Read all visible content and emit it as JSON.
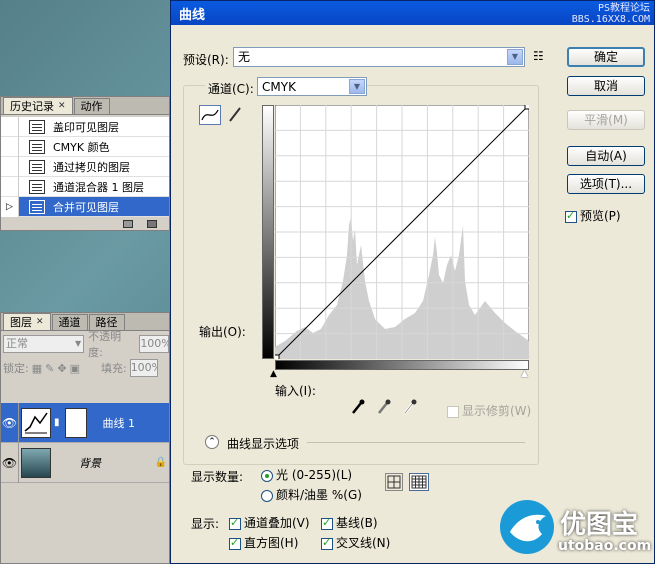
{
  "history_panel": {
    "tabs": [
      {
        "label": "历史记录"
      },
      {
        "label": "动作"
      }
    ],
    "items": [
      {
        "label": "盖印可见图层"
      },
      {
        "label": "CMYK 颜色"
      },
      {
        "label": "通过拷贝的图层"
      },
      {
        "label": "通道混合器 1 图层"
      },
      {
        "label": "合并可见图层"
      }
    ],
    "selected_index": 4
  },
  "layers_panel": {
    "tabs": [
      {
        "label": "图层"
      },
      {
        "label": "通道"
      },
      {
        "label": "路径"
      }
    ],
    "blend_mode": "正常",
    "opacity_label": "不透明度:",
    "opacity_value": "100%",
    "lock_label": "锁定:",
    "fill_label": "填充:",
    "fill_value": "100%",
    "layers": [
      {
        "name": "曲线 1",
        "selected": true
      },
      {
        "name": "背景",
        "selected": false
      }
    ]
  },
  "dialog": {
    "title": "曲线",
    "watermark_line1": "PS教程论坛",
    "watermark_line2": "BBS.16XX8.COM",
    "preset_label": "预设(R):",
    "preset_value": "无",
    "channel_label": "通道(C):",
    "channel_value": "CMYK",
    "output_label": "输出(O):",
    "input_label": "输入(I):",
    "show_clipping_label": "显示修剪(W)",
    "curve_options_label": "曲线显示选项",
    "show_amount_label": "显示数量:",
    "light_label": "光 (0-255)(L)",
    "pigment_label": "颜料/油墨 %(G)",
    "show_label": "显示:",
    "channel_overlay_label": "通道叠加(V)",
    "baseline_label": "基线(B)",
    "histogram_label": "直方图(H)",
    "intersection_label": "交叉线(N)",
    "ok_label": "确定",
    "cancel_label": "取消",
    "smooth_label": "平滑(M)",
    "auto_label": "自动(A)",
    "options_label": "选项(T)...",
    "preview_label": "预览(P)",
    "checked": {
      "preview": true,
      "overlay": true,
      "baseline": true,
      "histogram": true,
      "intersection": true,
      "clipping": false
    },
    "light_selected": true
  },
  "logo": {
    "cn": "优图宝",
    "url": "utobao.com"
  },
  "colors": {
    "title_blue": "#0a5be0",
    "selection_blue": "#3168c9",
    "dialog_bg": "#ece9d8"
  }
}
